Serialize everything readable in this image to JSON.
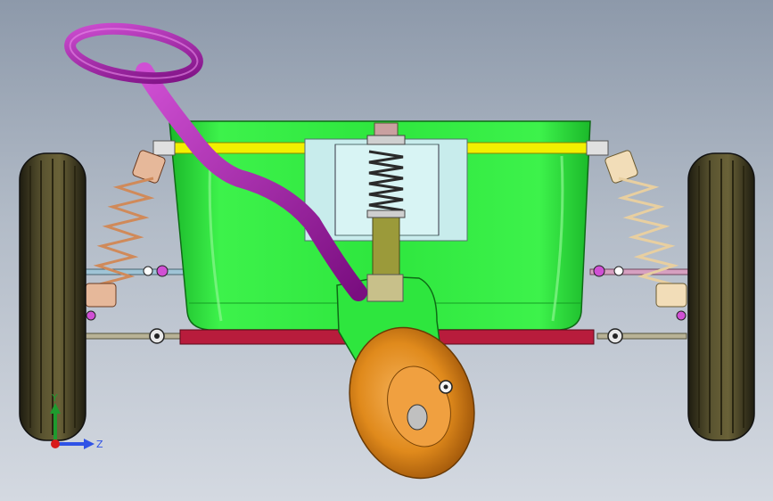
{
  "viewport": {
    "background_top": "#8d99aa",
    "background_bottom": "#d4d9e1"
  },
  "model": {
    "parts": [
      {
        "name": "handle-loop",
        "color": "#a31ea6"
      },
      {
        "name": "handle-bar",
        "color": "#a31ea6"
      },
      {
        "name": "tray",
        "color": "#2ee63e"
      },
      {
        "name": "top-rail",
        "color": "#f2f000"
      },
      {
        "name": "mount-plate",
        "color": "#c8ecec"
      },
      {
        "name": "center-spring",
        "color": "#444444"
      },
      {
        "name": "front-wheel-fork",
        "color": "#2ee63e"
      },
      {
        "name": "front-wheel",
        "color": "#e08a1c"
      },
      {
        "name": "front-axle",
        "color": "#b81c3c"
      },
      {
        "name": "left-shock-spring",
        "color": "#d08a5a"
      },
      {
        "name": "right-shock-spring",
        "color": "#e8cfa0"
      },
      {
        "name": "left-rear-wheel",
        "color": "#4a4426"
      },
      {
        "name": "right-rear-wheel",
        "color": "#4a4426"
      }
    ]
  },
  "triad": {
    "y_label": "Y",
    "z_label": "Z",
    "y_color": "#1e9b2e",
    "z_color": "#2f52e6",
    "x_color": "#d81a1a"
  }
}
